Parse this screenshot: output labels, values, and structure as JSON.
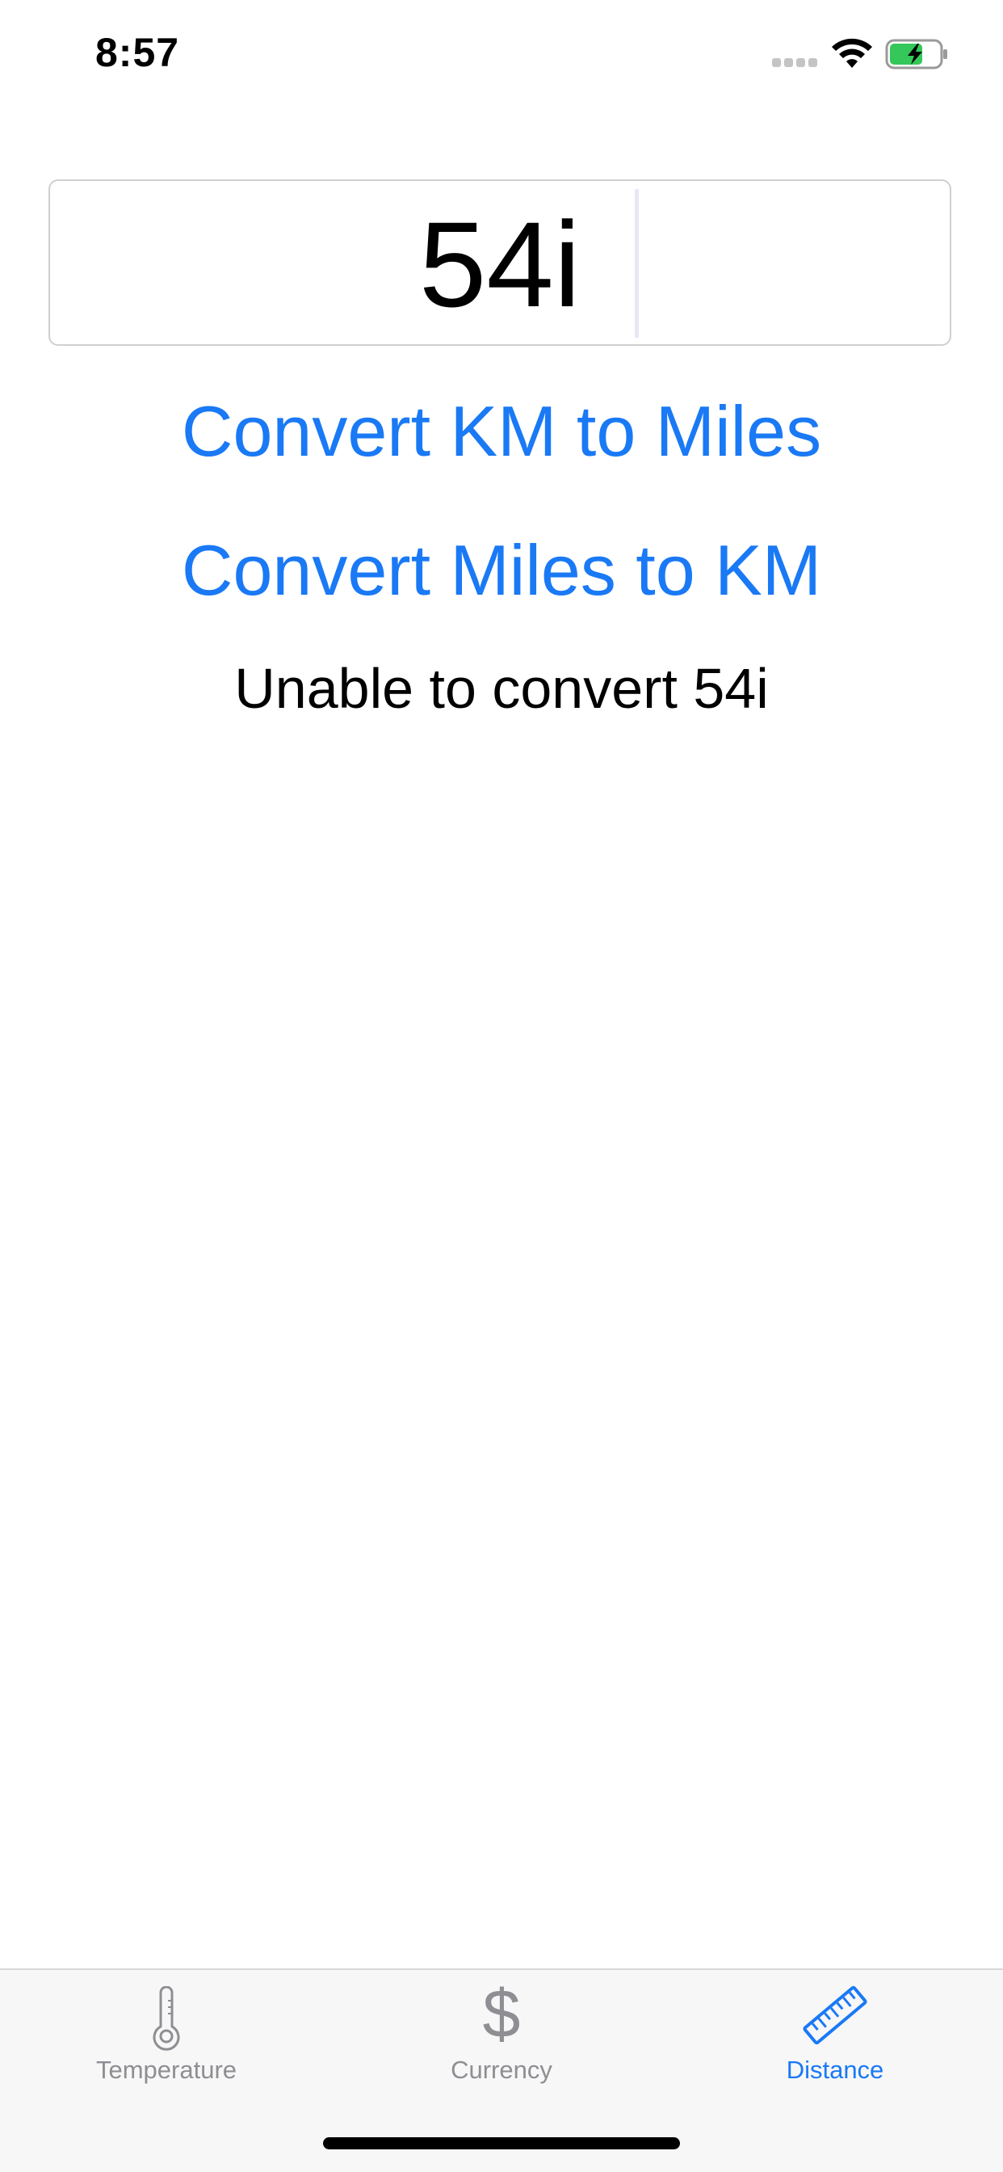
{
  "status_bar": {
    "time": "8:57"
  },
  "input": {
    "value": "54i"
  },
  "buttons": {
    "km_to_miles": "Convert KM to Miles",
    "miles_to_km": "Convert Miles to KM"
  },
  "result": {
    "text": "Unable to convert 54i"
  },
  "tab_bar": {
    "tabs": [
      {
        "label": "Temperature",
        "icon": "thermometer-icon",
        "selected": false
      },
      {
        "label": "Currency",
        "icon": "dollar-icon",
        "glyph": "$",
        "selected": false
      },
      {
        "label": "Distance",
        "icon": "ruler-icon",
        "selected": true
      }
    ]
  },
  "colors": {
    "accent": "#1a79f5",
    "inactive_tab": "#8e8e93",
    "battery_fill": "#34c759"
  }
}
